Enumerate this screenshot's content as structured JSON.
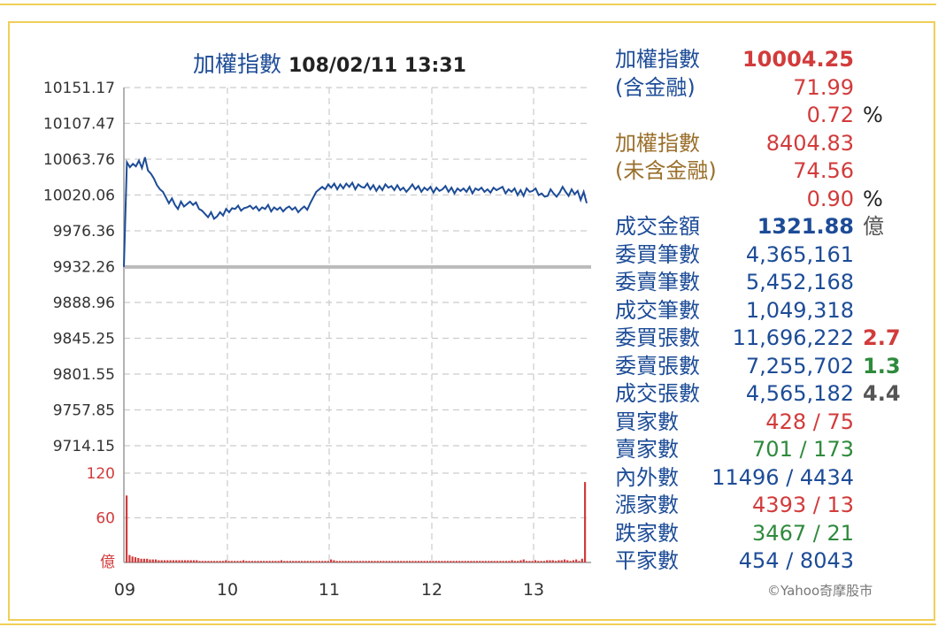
{
  "chart_data": {
    "type": "line",
    "title": "加權指數",
    "datetime": "108/02/11 13:31",
    "x_ticks": [
      "09",
      "10",
      "11",
      "12",
      "13"
    ],
    "y_ticks": [
      "10151.17",
      "10107.47",
      "10063.76",
      "10020.06",
      "9976.36",
      "9932.26",
      "9888.96",
      "9845.25",
      "9801.55",
      "9757.85",
      "9714.15"
    ],
    "y_range": [
      9714.15,
      10151.17
    ],
    "reference_value": 9932.26,
    "grid": true,
    "series": [
      {
        "values": [
          9932.3,
          10060,
          10054,
          10058,
          10055,
          10062,
          10053,
          10066,
          10050,
          10046,
          10040,
          10032,
          10027,
          10024,
          10017,
          10010,
          10016,
          10008,
          10003,
          10012,
          10006,
          10009,
          10012,
          10008,
          10011,
          10003,
          10001,
          9997,
          9993,
          9999,
          9991,
          9994,
          9999,
          9995,
          10003,
          9999,
          10004,
          10003,
          10007,
          10001,
          10004,
          10005,
          10007,
          10003,
          10006,
          10001,
          10005,
          10003,
          10008,
          10000,
          10005,
          10002,
          10005,
          10000,
          10004,
          10006,
          10002,
          10005,
          9999,
          10003,
          10006,
          10002,
          10010,
          10017,
          10024,
          10027,
          10030,
          10027,
          10033,
          10029,
          10034,
          10027,
          10033,
          10028,
          10034,
          10030,
          10035,
          10027,
          10033,
          10030,
          10029,
          10034,
          10027,
          10032,
          10025,
          10031,
          10026,
          10033,
          10029,
          10031,
          10026,
          10032,
          10026,
          10029,
          10024,
          10028,
          10033,
          10027,
          10031,
          10024,
          10029,
          10026,
          10030,
          10023,
          10029,
          10025,
          10027,
          10031,
          10024,
          10029,
          10022,
          10028,
          10025,
          10028,
          10024,
          10030,
          10022,
          10028,
          10026,
          10029,
          10024,
          10027,
          10023,
          10029,
          10026,
          10028,
          10030,
          10022,
          10027,
          10024,
          10028,
          10020,
          10026,
          10019,
          10028,
          10024,
          10025,
          10028,
          10020,
          10022,
          10018,
          10019,
          10027,
          10022,
          10018,
          10023,
          10030,
          10024,
          10019,
          10027,
          10021,
          10025,
          10014,
          10024,
          10010
        ]
      }
    ],
    "volume": {
      "label": "億",
      "y_ticks": [
        "120",
        "60"
      ],
      "y_range": [
        0,
        120
      ],
      "values": [
        90,
        10,
        8,
        7,
        6,
        5,
        5,
        5,
        4,
        4,
        4,
        3,
        3,
        3,
        3,
        3,
        3,
        3,
        3,
        3,
        3,
        3,
        3,
        3,
        3,
        2,
        2,
        2,
        2,
        2,
        2,
        2,
        2,
        2,
        3,
        2,
        2,
        2,
        2,
        2,
        3,
        2,
        2,
        2,
        2,
        2,
        2,
        2,
        2,
        2,
        2,
        2,
        2,
        3,
        2,
        2,
        2,
        2,
        2,
        2,
        2,
        2,
        2,
        2,
        2,
        2,
        2,
        2,
        2,
        2,
        4,
        3,
        2,
        2,
        2,
        2,
        2,
        2,
        2,
        2,
        2,
        2,
        2,
        2,
        2,
        2,
        2,
        2,
        2,
        2,
        2,
        2,
        2,
        2,
        2,
        2,
        2,
        2,
        2,
        2,
        2,
        2,
        2,
        2,
        2,
        2,
        2,
        2,
        2,
        2,
        2,
        2,
        2,
        2,
        2,
        2,
        2,
        2,
        2,
        2,
        2,
        2,
        2,
        2,
        2,
        2,
        2,
        2,
        2,
        2,
        2,
        2,
        3,
        2,
        2,
        3,
        4,
        2,
        2,
        2,
        3,
        2,
        2,
        2,
        3,
        3,
        3,
        2,
        3,
        3,
        4,
        3,
        2,
        3,
        4,
        2,
        5,
        108
      ]
    }
  },
  "colors": {
    "navy": "#1d4c97",
    "gold": "#9a6f2b",
    "red": "#d23b3b",
    "green": "#2e8a3c",
    "frame": "#f0cf57",
    "grid": "#cccccc",
    "reference": "#bbbbbb"
  },
  "stats": [
    {
      "label": "加權指數",
      "value": "10004.25",
      "extra": "",
      "label_color": "navy",
      "value_color": "red",
      "bold": true
    },
    {
      "label": "(含金融)",
      "value": "71.99",
      "extra": "",
      "label_color": "navy",
      "value_color": "red"
    },
    {
      "label": "",
      "value": "0.72",
      "extra": "%",
      "label_color": "navy",
      "value_color": "red",
      "extra_color": "dark"
    },
    {
      "label": "加權指數",
      "value": "8404.83",
      "extra": "",
      "label_color": "gold",
      "value_color": "red"
    },
    {
      "label": "(未含金融)",
      "value": "74.56",
      "extra": "",
      "label_color": "gold",
      "value_color": "red"
    },
    {
      "label": "",
      "value": "0.90",
      "extra": "%",
      "label_color": "gold",
      "value_color": "red",
      "extra_color": "dark"
    },
    {
      "label": "成交金額",
      "value": "1321.88",
      "extra": "億",
      "label_color": "navy",
      "value_color": "navy",
      "bold": true,
      "extra_color": "gray"
    },
    {
      "label": "委買筆數",
      "value": "4,365,161",
      "extra": "",
      "label_color": "navy",
      "value_color": "navy"
    },
    {
      "label": "委賣筆數",
      "value": "5,452,168",
      "extra": "",
      "label_color": "navy",
      "value_color": "navy"
    },
    {
      "label": "成交筆數",
      "value": "1,049,318",
      "extra": "",
      "label_color": "navy",
      "value_color": "navy"
    },
    {
      "label": "委買張數",
      "value": "11,696,222",
      "extra": "2.7",
      "label_color": "navy",
      "value_color": "navy",
      "extra_color": "red",
      "extra_bold": true
    },
    {
      "label": "委賣張數",
      "value": "7,255,702",
      "extra": "1.3",
      "label_color": "navy",
      "value_color": "navy",
      "extra_color": "green",
      "extra_bold": true
    },
    {
      "label": "成交張數",
      "value": "4,565,182",
      "extra": "4.4",
      "label_color": "navy",
      "value_color": "navy",
      "extra_color": "gray",
      "extra_bold": true
    },
    {
      "label": "買家數",
      "value": "428 / 75",
      "extra": "",
      "label_color": "navy",
      "value_color": "red"
    },
    {
      "label": "賣家數",
      "value": "701 / 173",
      "extra": "",
      "label_color": "navy",
      "value_color": "green"
    },
    {
      "label": "內外數",
      "value": "11496 / 4434",
      "extra": "",
      "label_color": "navy",
      "value_color": "navy"
    },
    {
      "label": "漲家數",
      "value": "4393 / 13",
      "extra": "",
      "label_color": "navy",
      "value_color": "red"
    },
    {
      "label": "跌家數",
      "value": "3467 / 21",
      "extra": "",
      "label_color": "navy",
      "value_color": "green"
    },
    {
      "label": "平家數",
      "value": "454 / 8043",
      "extra": "",
      "label_color": "navy",
      "value_color": "navy"
    }
  ],
  "copyright": "©Yahoo奇摩股市"
}
